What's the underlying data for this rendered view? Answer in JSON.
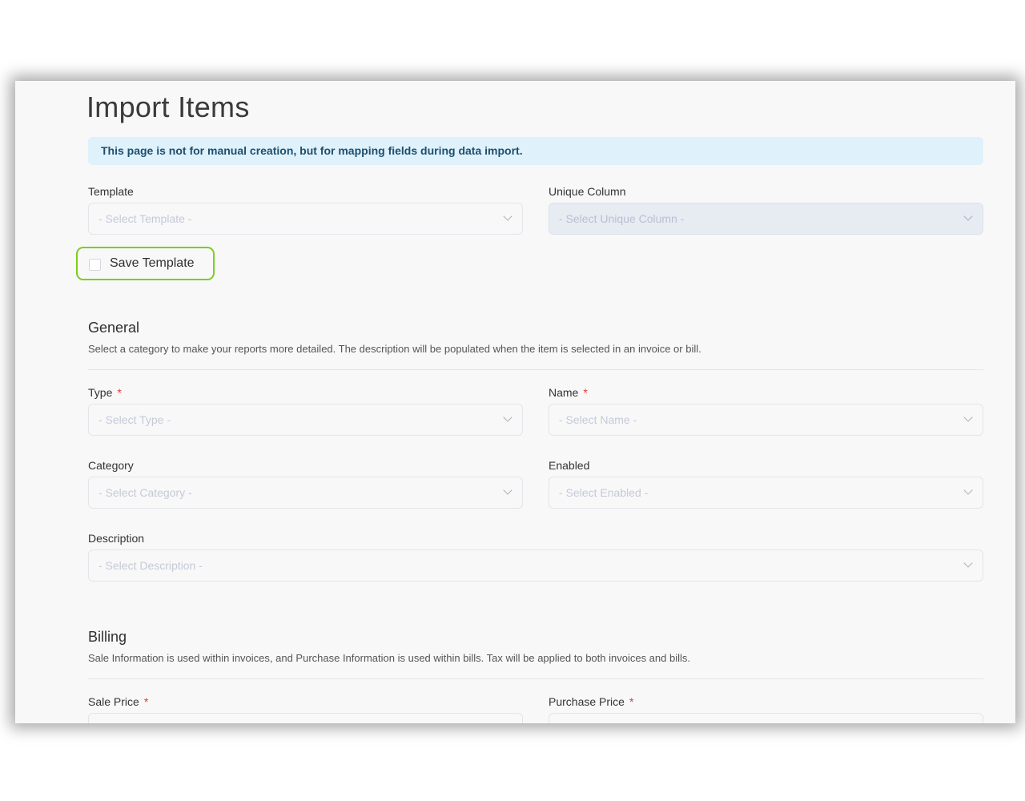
{
  "page": {
    "title": "Import Items",
    "notice": "This page is not for manual creation, but for mapping fields during data import."
  },
  "template_field": {
    "label": "Template",
    "placeholder": "- Select Template -"
  },
  "unique_column_field": {
    "label": "Unique Column",
    "placeholder": "- Select Unique Column -",
    "disabled": true
  },
  "save_template": {
    "label": "Save Template",
    "checked": false,
    "highlight_color": "#7ccf1b"
  },
  "general": {
    "title": "General",
    "description": "Select a category to make your reports more detailed. The description will be populated when the item is selected in an invoice or bill.",
    "fields": {
      "type": {
        "label": "Type",
        "required_mark": "*",
        "placeholder": "- Select Type -"
      },
      "name": {
        "label": "Name",
        "required_mark": "*",
        "placeholder": "- Select Name -"
      },
      "category": {
        "label": "Category",
        "placeholder": "- Select Category -"
      },
      "enabled": {
        "label": "Enabled",
        "placeholder": "- Select Enabled -"
      },
      "description": {
        "label": "Description",
        "placeholder": "- Select Description -"
      }
    }
  },
  "billing": {
    "title": "Billing",
    "description": "Sale Information is used within invoices, and Purchase Information is used within bills. Tax will be applied to both invoices and bills.",
    "fields": {
      "sale_price": {
        "label": "Sale Price",
        "required_mark": "*"
      },
      "purchase_price": {
        "label": "Purchase Price",
        "required_mark": "*"
      }
    }
  },
  "colors": {
    "notice_bg": "#dff1fb",
    "notice_text": "#1e4f6e",
    "required": "#e53935"
  }
}
